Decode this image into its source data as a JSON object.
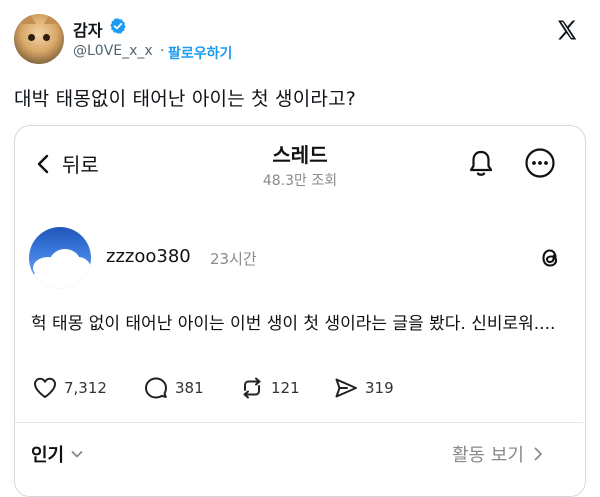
{
  "tweet": {
    "author_name": "감자",
    "handle": "@L0VE_x_x",
    "separator": "·",
    "follow_label": "팔로우하기",
    "text": "대박 태몽없이 태어난 아이는 첫 생이라고?"
  },
  "embed": {
    "back_label": "뒤로",
    "title": "스레드",
    "views": "48.3만 조회",
    "post": {
      "username": "zzzoo380",
      "time": "23시간",
      "body": "헉 태몽 없이 태어난 아이는 이번 생이 첫 생이라는 글을 봤다. 신비로워...."
    },
    "actions": {
      "likes": "7,312",
      "comments": "381",
      "reposts": "121",
      "shares": "319"
    },
    "sort_label": "인기",
    "activity_label": "활동 보기"
  },
  "icons": {
    "avatar": "cat-photo",
    "verified": "verified-badge-icon",
    "x_logo": "x-logo-icon",
    "back": "chevron-left-icon",
    "bell": "bell-icon",
    "more": "more-icon",
    "threads": "threads-logo-icon",
    "like": "heart-icon",
    "comment": "comment-icon",
    "repost": "repost-icon",
    "share": "share-icon"
  },
  "colors": {
    "accent": "#1d9bf0",
    "text": "#0f1419",
    "muted": "#8a8a8a"
  }
}
